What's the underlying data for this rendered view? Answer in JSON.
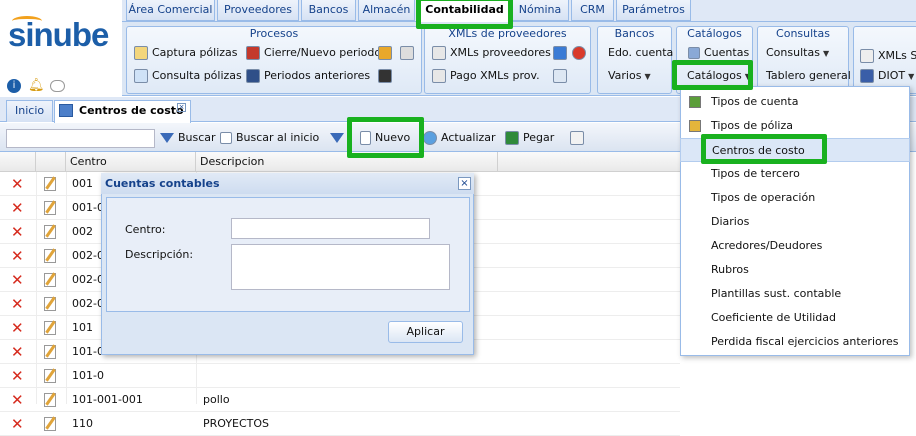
{
  "brand": {
    "logo_text": "sinube"
  },
  "main_tabs": [
    "Área Comercial",
    "Proveedores",
    "Bancos",
    "Almacén",
    "Contabilidad",
    "Nómina",
    "CRM",
    "Parámetros"
  ],
  "ribbon": {
    "procesos": {
      "title": "Procesos",
      "items": [
        "Captura pólizas",
        "Cierre/Nuevo periodo",
        "Consulta pólizas",
        "Periodos anteriores"
      ]
    },
    "xmls": {
      "title": "XMLs de proveedores",
      "items": [
        "XMLs proveedores",
        "Pago XMLs prov."
      ]
    },
    "bancos": {
      "title": "Bancos",
      "items": [
        "Edo. cuenta",
        "Varios"
      ]
    },
    "catalogos": {
      "title": "Catálogos",
      "items": [
        "Cuentas",
        "Catálogos"
      ]
    },
    "consultas": {
      "title": "Consultas",
      "items": [
        "Consultas",
        "Tablero general"
      ]
    },
    "extra": {
      "items": [
        "XMLs S",
        "DIOT"
      ]
    }
  },
  "doc_tabs": {
    "home": "Inicio",
    "active": "Centros de costo"
  },
  "toolbar": {
    "buscar": "Buscar",
    "buscar_inicio": "Buscar al inicio",
    "nuevo": "Nuevo",
    "actualizar": "Actualizar",
    "pegar": "Pegar"
  },
  "grid": {
    "headers": [
      "Centro",
      "Descripcion"
    ],
    "rows": [
      {
        "centro": "001",
        "descripcion": ""
      },
      {
        "centro": "001-0",
        "descripcion": ""
      },
      {
        "centro": "002",
        "descripcion": ""
      },
      {
        "centro": "002-0",
        "descripcion": ""
      },
      {
        "centro": "002-0",
        "descripcion": ""
      },
      {
        "centro": "002-0",
        "descripcion": ""
      },
      {
        "centro": "101",
        "descripcion": ""
      },
      {
        "centro": "101-0",
        "descripcion": ""
      },
      {
        "centro": "101-0",
        "descripcion": ""
      },
      {
        "centro": "101-001-001",
        "descripcion": "pollo"
      },
      {
        "centro": "110",
        "descripcion": "PROYECTOS"
      }
    ]
  },
  "dialog": {
    "title": "Cuentas contables",
    "centro_label": "Centro:",
    "descripcion_label": "Descripción:",
    "centro_value": "",
    "descripcion_value": "",
    "apply": "Aplicar"
  },
  "menu": [
    "Tipos de cuenta",
    "Tipos de póliza",
    "Centros de costo",
    "Tipos de tercero",
    "Tipos de operación",
    "Diarios",
    "Acredores/Deudores",
    "Rubros",
    "Plantillas sust. contable",
    "Coeficiente de Utilidad",
    "Perdida fiscal ejercicios anteriores"
  ],
  "colors": {
    "highlight": "#19b11f",
    "header_blue": "#15428b",
    "border_blue": "#99bbe8"
  }
}
